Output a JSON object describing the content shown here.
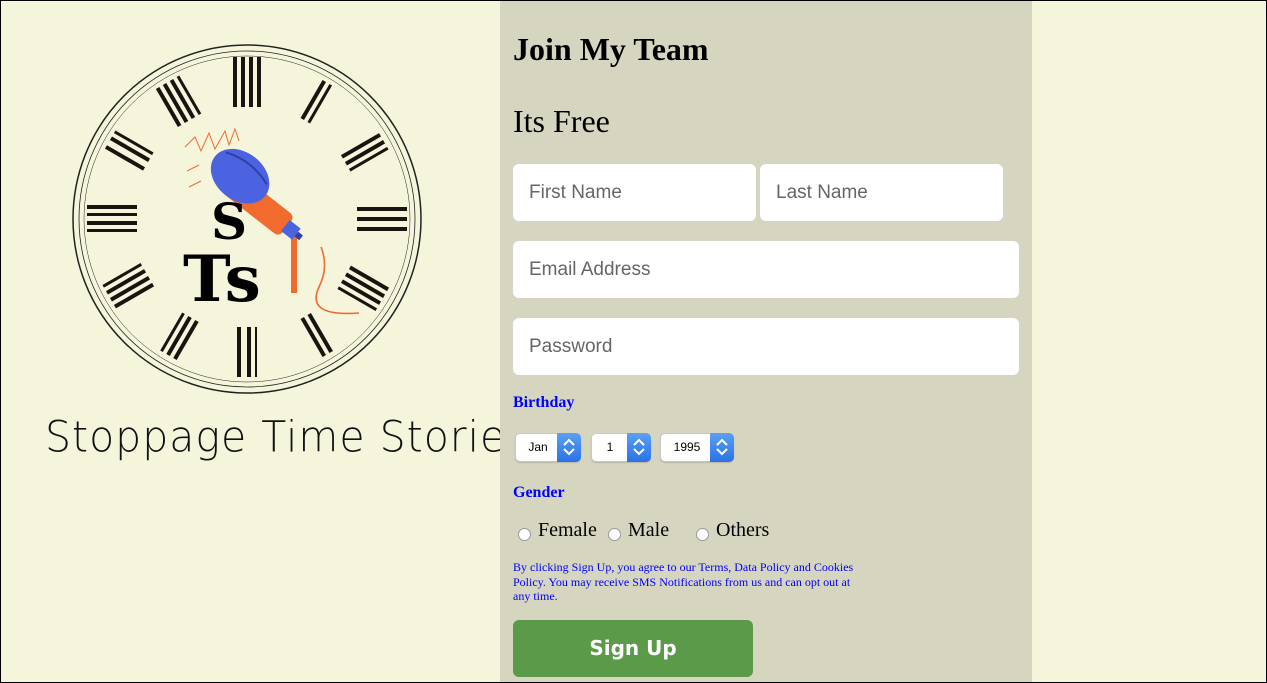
{
  "brand": {
    "name": "Stoppage Time Stories",
    "logo_letters": [
      "S",
      "Ts"
    ]
  },
  "form": {
    "title": "Join My Team",
    "subtitle": "Its Free",
    "first_name_placeholder": "First Name",
    "last_name_placeholder": "Last Name",
    "email_placeholder": "Email Address",
    "password_placeholder": "Password",
    "birthday_label": "Birthday",
    "birthday": {
      "month": "Jan",
      "day": "1",
      "year": "1995"
    },
    "gender_label": "Gender",
    "gender_options": [
      "Female",
      "Male",
      "Others"
    ],
    "terms_text": "By clicking Sign Up, you agree to our Terms, Data Policy and Cookies Policy. You may receive SMS Notifications from us and can opt out at any time.",
    "signup_label": "Sign Up"
  },
  "colors": {
    "page_background": "#f5f5dc",
    "panel_background": "#d6d5c0",
    "label_blue": "#0000ff",
    "signup_green": "#5b9a49",
    "select_arrow_blue": "#2a72e6",
    "mic_blue": "#4b63e0",
    "mic_orange": "#f26b2e"
  },
  "icons": [
    "clock-logo-icon",
    "microphone-icon",
    "chevron-updown-icon"
  ]
}
